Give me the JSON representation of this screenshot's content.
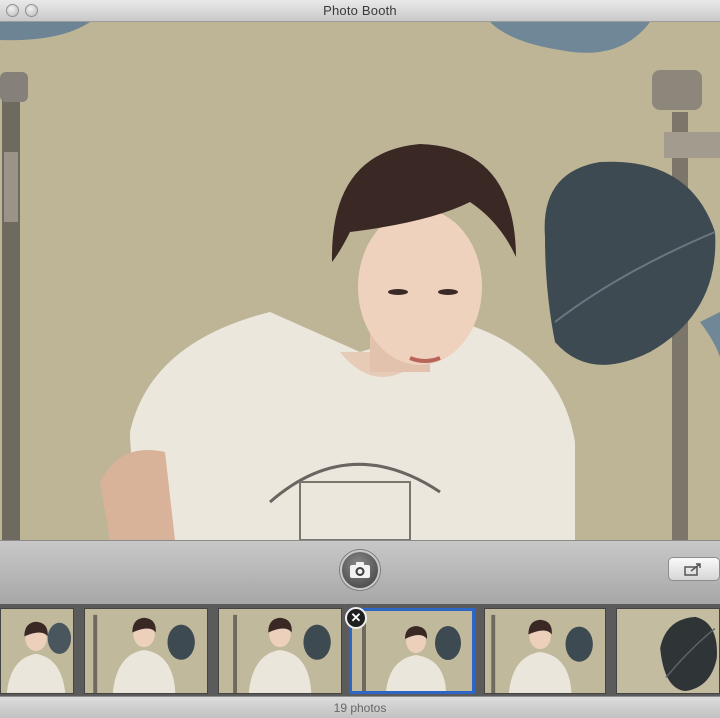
{
  "window": {
    "title": "Photo Booth"
  },
  "toolbar": {
    "shutter_icon": "camera-icon",
    "share_icon": "share-icon"
  },
  "filmstrip": {
    "thumbnails": [
      {
        "subject": "person"
      },
      {
        "subject": "person"
      },
      {
        "subject": "person"
      },
      {
        "subject": "person",
        "selected": true
      },
      {
        "subject": "person"
      },
      {
        "subject": "leaf"
      }
    ],
    "selected_index": 3,
    "delete_icon": "close-icon",
    "delete_glyph": "✕"
  },
  "status": {
    "photo_count": "19 photos"
  },
  "colors": {
    "selection": "#2d66c4",
    "backdrop": "#bfb698"
  }
}
